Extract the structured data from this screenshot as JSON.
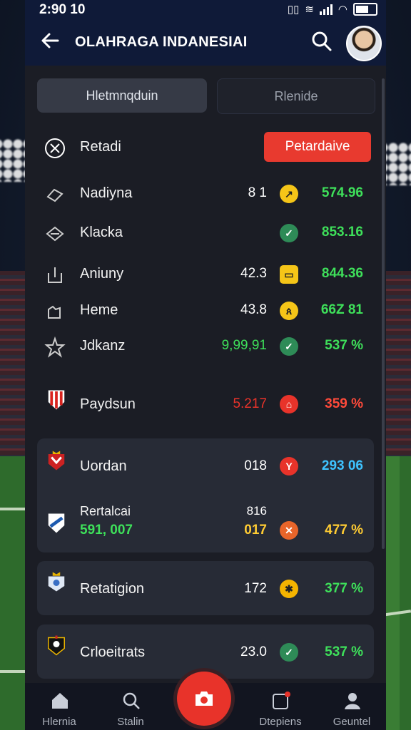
{
  "status_bar": {
    "time": "2:90 10"
  },
  "header": {
    "title": "OLAHRAGA  INDANESIAI"
  },
  "tabs": [
    {
      "label": "Hletmnqduin"
    },
    {
      "label": "Rlenide"
    }
  ],
  "section": {
    "title": "Retadi",
    "action_label": "Petardaive"
  },
  "rows": [
    {
      "name": "Nadiyna",
      "value": "8 1",
      "badge_color": "#f5c518",
      "percent": "574.96",
      "percent_color": "#3ee05a"
    },
    {
      "name": "Klacka",
      "value": "",
      "badge_color": "#2e8b57",
      "percent": "853.16",
      "percent_color": "#3ee05a"
    },
    {
      "name": "Aniuny",
      "value": "42.3",
      "badge_color": "#f5c518",
      "percent": "844.36",
      "percent_color": "#3ee05a"
    },
    {
      "name": "Heme",
      "value": "43.8",
      "badge_color": "#f5c518",
      "percent": "66Z 81",
      "percent_color": "#3ee05a"
    },
    {
      "name": "Jdkanz",
      "value": "9,99,91",
      "value_color": "#3ee05a",
      "badge_color": "#2e8b57",
      "percent": "537 %",
      "percent_color": "#3ee05a"
    }
  ],
  "team_rows": [
    {
      "name": "Paydsun",
      "value": "5.217",
      "value_color": "#e8332a",
      "badge_color": "#e8332a",
      "percent": "359 %",
      "percent_color": "#ff4a3a"
    }
  ],
  "cards": [
    {
      "items": [
        {
          "name": "Uordan",
          "value": "018",
          "badge_color": "#e8332a",
          "percent": "293 06",
          "percent_color": "#3ec3ff"
        },
        {
          "name": "Rertalcai",
          "sub": "591, 007",
          "value_top": "816",
          "value": "017",
          "value_color": "#ffcc33",
          "badge_color": "#e8652a",
          "percent": "477 %",
          "percent_color": "#ffcc33"
        }
      ]
    },
    {
      "items": [
        {
          "name": "Retatigion",
          "value": "172",
          "badge_color": "#f5b400",
          "percent": "377 %",
          "percent_color": "#3ee05a"
        }
      ]
    },
    {
      "items": [
        {
          "name": "Crloeitrats",
          "value": "23.0",
          "badge_color": "#2e8b57",
          "percent": "537 %",
          "percent_color": "#3ee05a"
        }
      ]
    }
  ],
  "bottom_nav": [
    {
      "label": "Hlernia",
      "icon": "home-icon"
    },
    {
      "label": "Stalin",
      "icon": "search-icon"
    },
    {
      "label": "Dtepiens",
      "icon": "notifications-icon"
    },
    {
      "label": "Geuntel",
      "icon": "profile-icon"
    }
  ]
}
